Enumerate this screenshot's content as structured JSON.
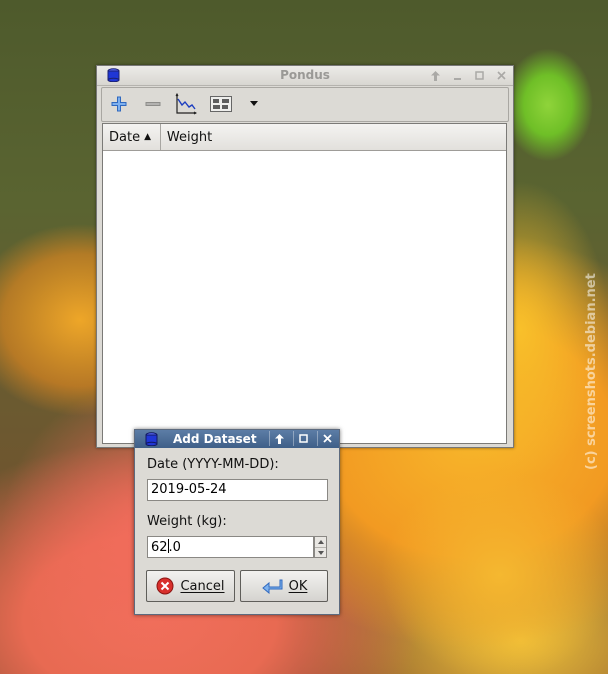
{
  "main_window": {
    "title": "Pondus",
    "toolbar": {
      "add_icon": "plus-icon",
      "remove_icon": "minus-icon",
      "plot_icon": "plot-icon",
      "preferences_icon": "preferences-icon",
      "more_icon": "dropdown-arrow-icon"
    },
    "table": {
      "columns": [
        "Date",
        "Weight"
      ],
      "sort_indicator": "▲",
      "rows": []
    }
  },
  "dialog": {
    "title": "Add Dataset",
    "date_label": "Date (YYYY-MM-DD):",
    "date_value": "2019-05-24",
    "weight_label": "Weight (kg):",
    "weight_value_before_cursor": "62",
    "weight_value_after_cursor": ".0",
    "cancel_label": "Cancel",
    "ok_label": "OK"
  },
  "watermark": "(c) screenshots.debian.net",
  "colors": {
    "dialog_title_bg": "#4a6a94",
    "cancel_icon": "#d8302c",
    "ok_icon": "#3b79c9",
    "toolbar_plus": "#3d7dd6"
  }
}
